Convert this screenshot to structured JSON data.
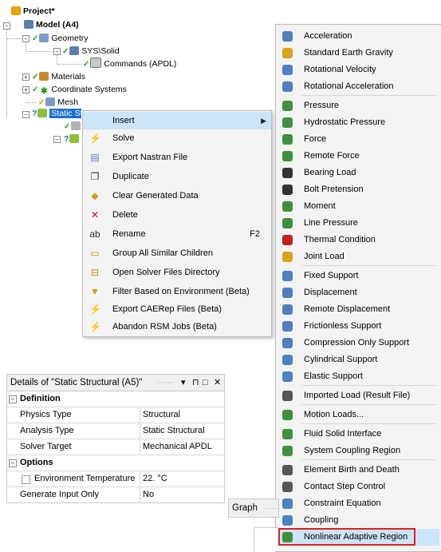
{
  "tree": {
    "project": "Project*",
    "model": "Model (A4)",
    "geometry": "Geometry",
    "sys_solid": "SYS\\Solid",
    "commands": "Commands (APDL)",
    "materials": "Materials",
    "coordinate_systems": "Coordinate Systems",
    "mesh": "Mesh",
    "static_structural": "Static Structural (A5)"
  },
  "context_menu": {
    "items": [
      {
        "label": "Insert",
        "icon": "insert-icon",
        "highlighted": true,
        "has_submenu": true
      },
      {
        "label": "Solve",
        "icon": "solve-bolt-icon"
      },
      {
        "label": "Export Nastran File",
        "icon": "export-file-icon"
      },
      {
        "label": "Duplicate",
        "icon": "duplicate-icon"
      },
      {
        "label": "Clear Generated Data",
        "icon": "eraser-icon"
      },
      {
        "label": "Delete",
        "icon": "delete-x-icon"
      },
      {
        "label": "Rename",
        "icon": "rename-icon",
        "shortcut": "F2"
      },
      {
        "label": "Group All Similar Children",
        "icon": "folder-icon"
      },
      {
        "label": "Open Solver Files Directory",
        "icon": "open-folder-icon"
      },
      {
        "label": "Filter Based on Environment (Beta)",
        "icon": "filter-icon"
      },
      {
        "label": "Export CAERep Files (Beta)",
        "icon": "bolt-icon"
      },
      {
        "label": "Abandon RSM Jobs (Beta)",
        "icon": "bolt-icon"
      }
    ]
  },
  "submenu": {
    "items": [
      {
        "label": "Acceleration",
        "icon": "acceleration-icon"
      },
      {
        "label": "Standard Earth Gravity",
        "icon": "gravity-icon"
      },
      {
        "label": "Rotational Velocity",
        "icon": "rotational-velocity-icon"
      },
      {
        "label": "Rotational Acceleration",
        "icon": "rotational-acceleration-icon"
      },
      {
        "label": "Pressure",
        "icon": "pressure-icon"
      },
      {
        "label": "Hydrostatic Pressure",
        "icon": "hydrostatic-pressure-icon"
      },
      {
        "label": "Force",
        "icon": "force-icon"
      },
      {
        "label": "Remote Force",
        "icon": "remote-force-icon"
      },
      {
        "label": "Bearing Load",
        "icon": "bearing-load-icon"
      },
      {
        "label": "Bolt Pretension",
        "icon": "bolt-pretension-icon"
      },
      {
        "label": "Moment",
        "icon": "moment-icon"
      },
      {
        "label": "Line Pressure",
        "icon": "line-pressure-icon"
      },
      {
        "label": "Thermal Condition",
        "icon": "thermal-condition-icon"
      },
      {
        "label": "Joint Load",
        "icon": "joint-load-icon"
      },
      {
        "label": "Fixed Support",
        "icon": "fixed-support-icon"
      },
      {
        "label": "Displacement",
        "icon": "displacement-icon"
      },
      {
        "label": "Remote Displacement",
        "icon": "remote-displacement-icon"
      },
      {
        "label": "Frictionless Support",
        "icon": "frictionless-support-icon"
      },
      {
        "label": "Compression Only Support",
        "icon": "compression-only-support-icon"
      },
      {
        "label": "Cylindrical Support",
        "icon": "cylindrical-support-icon"
      },
      {
        "label": "Elastic Support",
        "icon": "elastic-support-icon"
      },
      {
        "label": "Imported Load (Result File)",
        "icon": "imported-load-icon"
      },
      {
        "label": "Motion Loads...",
        "icon": "motion-loads-icon"
      },
      {
        "label": "Fluid Solid Interface",
        "icon": "fluid-solid-interface-icon"
      },
      {
        "label": "System Coupling Region",
        "icon": "system-coupling-icon"
      },
      {
        "label": "Element Birth and Death",
        "icon": "element-birth-death-icon"
      },
      {
        "label": "Contact Step Control",
        "icon": "contact-step-control-icon"
      },
      {
        "label": "Constraint Equation",
        "icon": "constraint-equation-icon"
      },
      {
        "label": "Coupling",
        "icon": "coupling-icon"
      },
      {
        "label": "Nonlinear Adaptive Region",
        "icon": "nonlinear-adaptive-region-icon",
        "outlined": true
      }
    ]
  },
  "details": {
    "title": "Details of \"Static Structural (A5)\"",
    "controls": {
      "pin": "▾",
      "autohide": "⊓",
      "maximize": "□",
      "close": "✕"
    },
    "sections": {
      "definition": "Definition",
      "options": "Options"
    },
    "rows": {
      "physics_type": {
        "key": "Physics Type",
        "value": "Structural"
      },
      "analysis_type": {
        "key": "Analysis Type",
        "value": "Static Structural"
      },
      "solver_target": {
        "key": "Solver Target",
        "value": "Mechanical APDL"
      },
      "env_temp": {
        "key": "Environment Temperature",
        "value": "22. °C"
      },
      "gen_input": {
        "key": "Generate Input Only",
        "value": "No"
      }
    }
  },
  "graph": {
    "label": "Graph"
  },
  "colors": {
    "highlight": "#cce4f7",
    "outline": "#e01e1e",
    "menu_bg": "#f3f3f3"
  }
}
